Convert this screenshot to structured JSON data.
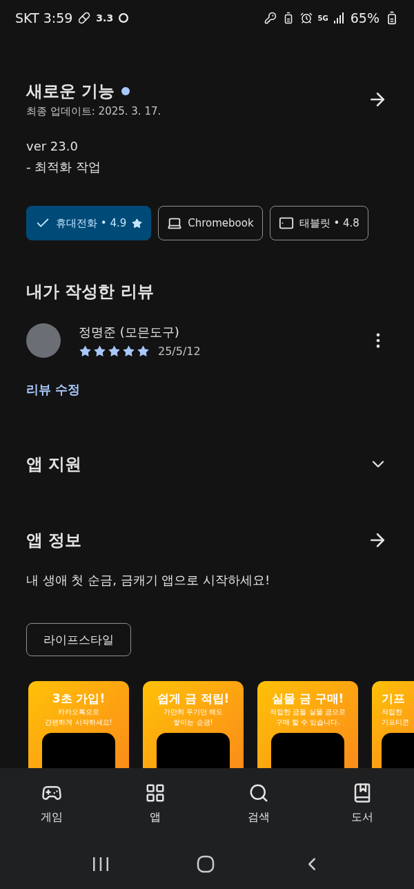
{
  "status_bar": {
    "carrier_time": "SKT 3:59",
    "data_speed": "3.3",
    "network": "5G",
    "battery": "65%"
  },
  "whats_new": {
    "title": "새로운 기능",
    "updated": "최종 업데이트: 2025. 3. 17.",
    "version": "ver 23.0",
    "notes": "- 최적화 작업"
  },
  "device_chips": [
    {
      "kind": "phone",
      "label": "휴대전화 • 4.9",
      "selected": true
    },
    {
      "kind": "laptop",
      "label": "Chromebook",
      "selected": false
    },
    {
      "kind": "tablet",
      "label": "태블릿 • 4.8",
      "selected": false
    }
  ],
  "my_review": {
    "heading": "내가 작성한 리뷰",
    "author": "정명준 (모믄도구)",
    "stars": 5,
    "date": "25/5/12",
    "edit_link": "리뷰 수정"
  },
  "app_support": {
    "title": "앱 지원",
    "expanded": false
  },
  "app_info": {
    "title": "앱 정보",
    "description": "내 생애 첫 순금, 금캐기 앱으로 시작하세요!",
    "tag": "라이프스타일"
  },
  "screenshots": [
    {
      "title": "3초 가입!",
      "lines": [
        "카카오톡으로",
        "간편하게 시작하세요!"
      ]
    },
    {
      "title": "쉽게 금 적립!",
      "lines": [
        "가만히 두기만 해도",
        "쌓이는 순금!"
      ]
    },
    {
      "title": "실물 금 구매!",
      "lines": [
        "적립한 금을 실물 금으로",
        "구매 할 수 있습니다."
      ]
    },
    {
      "title": "기프",
      "lines": [
        "적립한",
        "기프티콘"
      ]
    }
  ],
  "bottom_nav": [
    {
      "kind": "games",
      "label": "게임",
      "selected": false
    },
    {
      "kind": "apps",
      "label": "앱",
      "selected": false
    },
    {
      "kind": "search",
      "label": "검색",
      "selected": false
    },
    {
      "kind": "books",
      "label": "도서",
      "selected": false
    }
  ]
}
